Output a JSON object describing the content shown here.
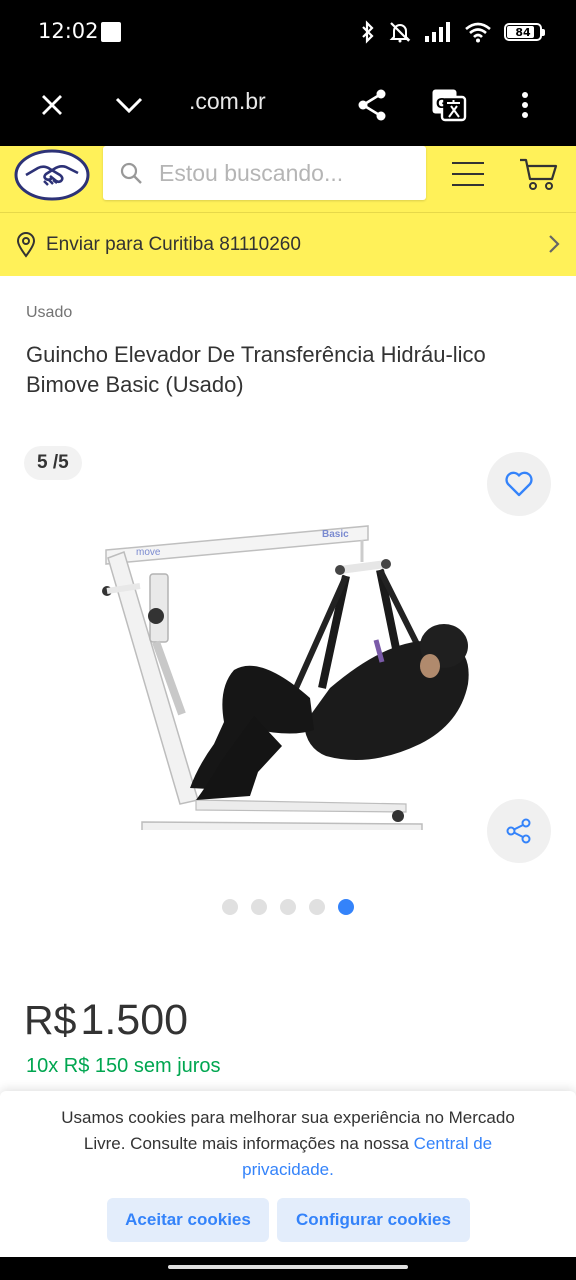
{
  "status_bar": {
    "time": "12:02",
    "battery": "84",
    "battery_level": 0.84
  },
  "browser": {
    "url": ".com.br"
  },
  "header": {
    "search_placeholder": "Estou buscando...",
    "ship_to": "Enviar para Curitiba 81110260"
  },
  "product": {
    "condition": "Usado",
    "title": "Guincho Elevador De Transferência Hidráu-lico Bimove Basic (Usado)",
    "image_counter": "5 /5",
    "total_images": 5,
    "current_image": 5,
    "image_labels": {
      "brand": "move",
      "model": "Basic"
    },
    "price_currency": "R$",
    "price_value": "1.500",
    "installments": "10x R$ 150 sem juros"
  },
  "cookies": {
    "text": "Usamos cookies para melhorar sua experiência no Mercado Livre. Consulte mais informações na nossa",
    "link": "Central de privacidade.",
    "accept_label": "Aceitar cookies",
    "config_label": "Configurar cookies"
  },
  "colors": {
    "brand_yellow": "#fff159",
    "accent_blue": "#3483fa",
    "installments_green": "#00a650"
  },
  "icons": [
    "close-icon",
    "chevron-down-icon",
    "share-icon",
    "translate-icon",
    "more-icon",
    "search-icon",
    "hamburger-icon",
    "cart-icon",
    "location-pin-icon",
    "chevron-right-icon",
    "heart-icon"
  ]
}
